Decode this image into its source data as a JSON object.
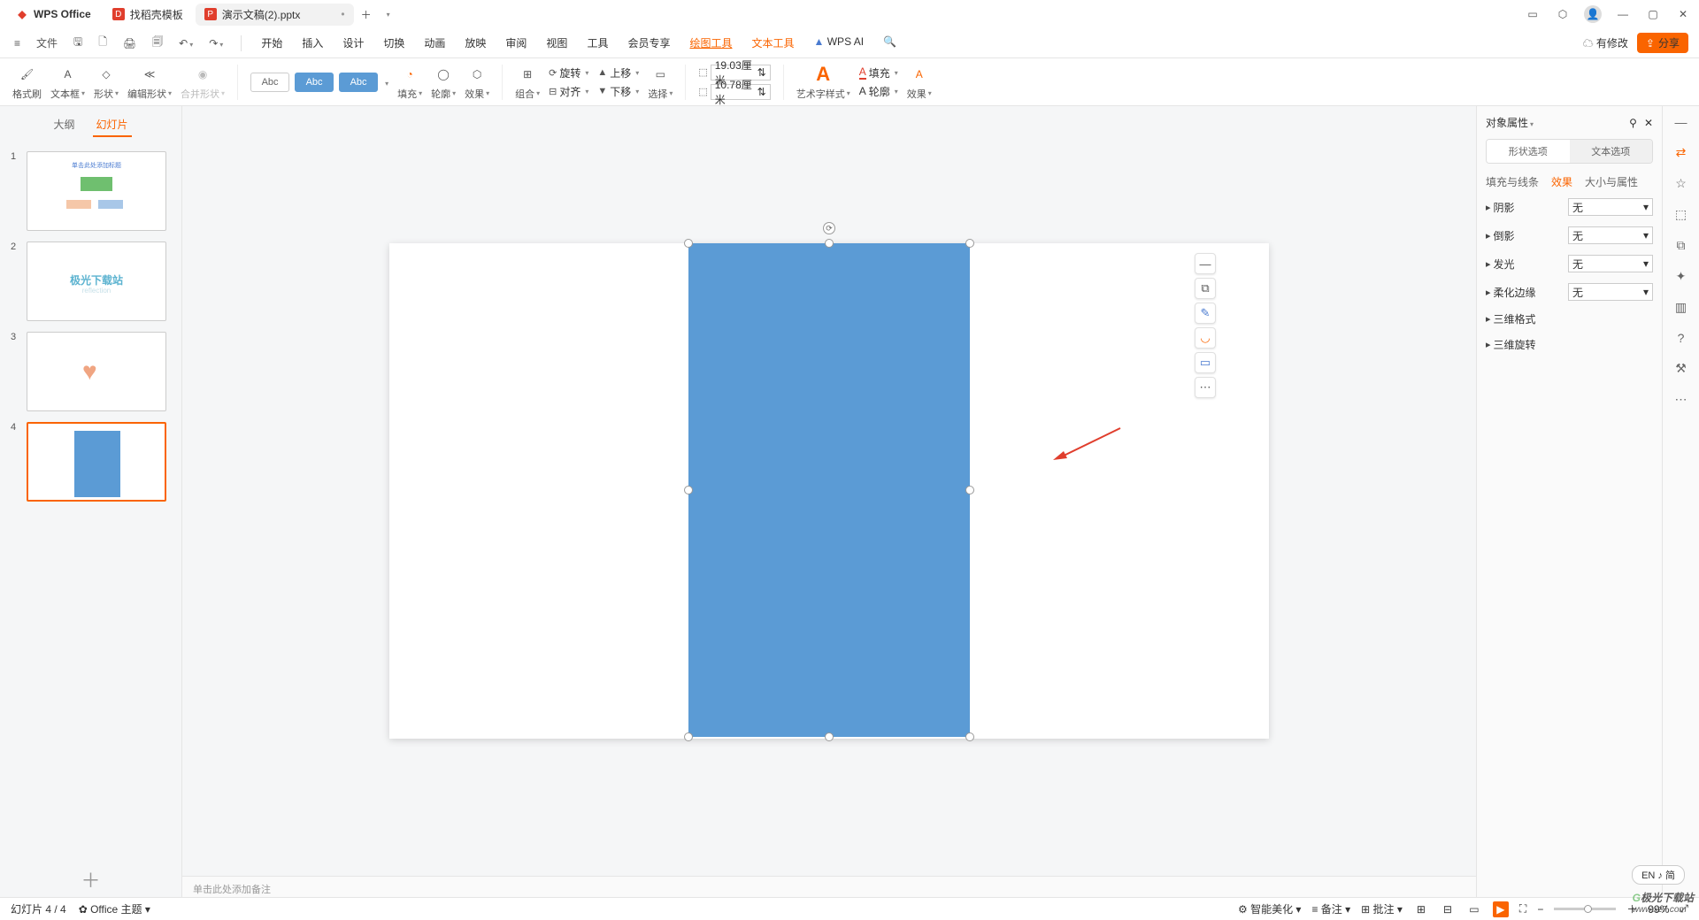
{
  "titlebar": {
    "app": "WPS Office",
    "template_tab": "找稻壳模板",
    "doc_tab": "演示文稿(2).pptx"
  },
  "menubar": {
    "file": "文件",
    "tabs": [
      "开始",
      "插入",
      "设计",
      "切换",
      "动画",
      "放映",
      "审阅",
      "视图",
      "工具",
      "会员专享",
      "绘图工具",
      "文本工具"
    ],
    "ai": "WPS AI",
    "modified": "有修改",
    "share": "分享"
  },
  "ribbon": {
    "format_painter": "格式刷",
    "textbox": "文本框",
    "shape": "形状",
    "edit_shape": "编辑形状",
    "merge_shape": "合并形状",
    "abc": "Abc",
    "fill": "填充",
    "outline": "轮廓",
    "effect": "效果",
    "group": "组合",
    "align": "对齐",
    "rotate": "旋转",
    "up": "上移",
    "down": "下移",
    "select": "选择",
    "width": "19.03厘米",
    "height": "10.78厘米",
    "art": "艺术字样式",
    "fill2": "填充",
    "outline2": "轮廓",
    "effect2": "效果"
  },
  "sidepanel": {
    "outline": "大纲",
    "slides": "幻灯片"
  },
  "thumbs": {
    "s2_text": "极光下载站",
    "s1_text": "单击此处添加标题"
  },
  "notes": {
    "placeholder": "单击此处添加备注"
  },
  "props": {
    "title": "对象属性",
    "shape_opt": "形状选项",
    "text_opt": "文本选项",
    "sub": [
      "填充与线条",
      "效果",
      "大小与属性"
    ],
    "shadow": "阴影",
    "reflection": "倒影",
    "glow": "发光",
    "soft": "柔化边缘",
    "fmt3d": "三维格式",
    "rot3d": "三维旋转",
    "none": "无"
  },
  "status": {
    "slide": "幻灯片 4 / 4",
    "theme": "Office 主题",
    "beautify": "智能美化",
    "notes": "备注",
    "comment": "批注",
    "zoom": "99%"
  },
  "lang": "EN ♪ 简",
  "wm": {
    "a": "极光下载站",
    "b": "www.xz7.com"
  }
}
